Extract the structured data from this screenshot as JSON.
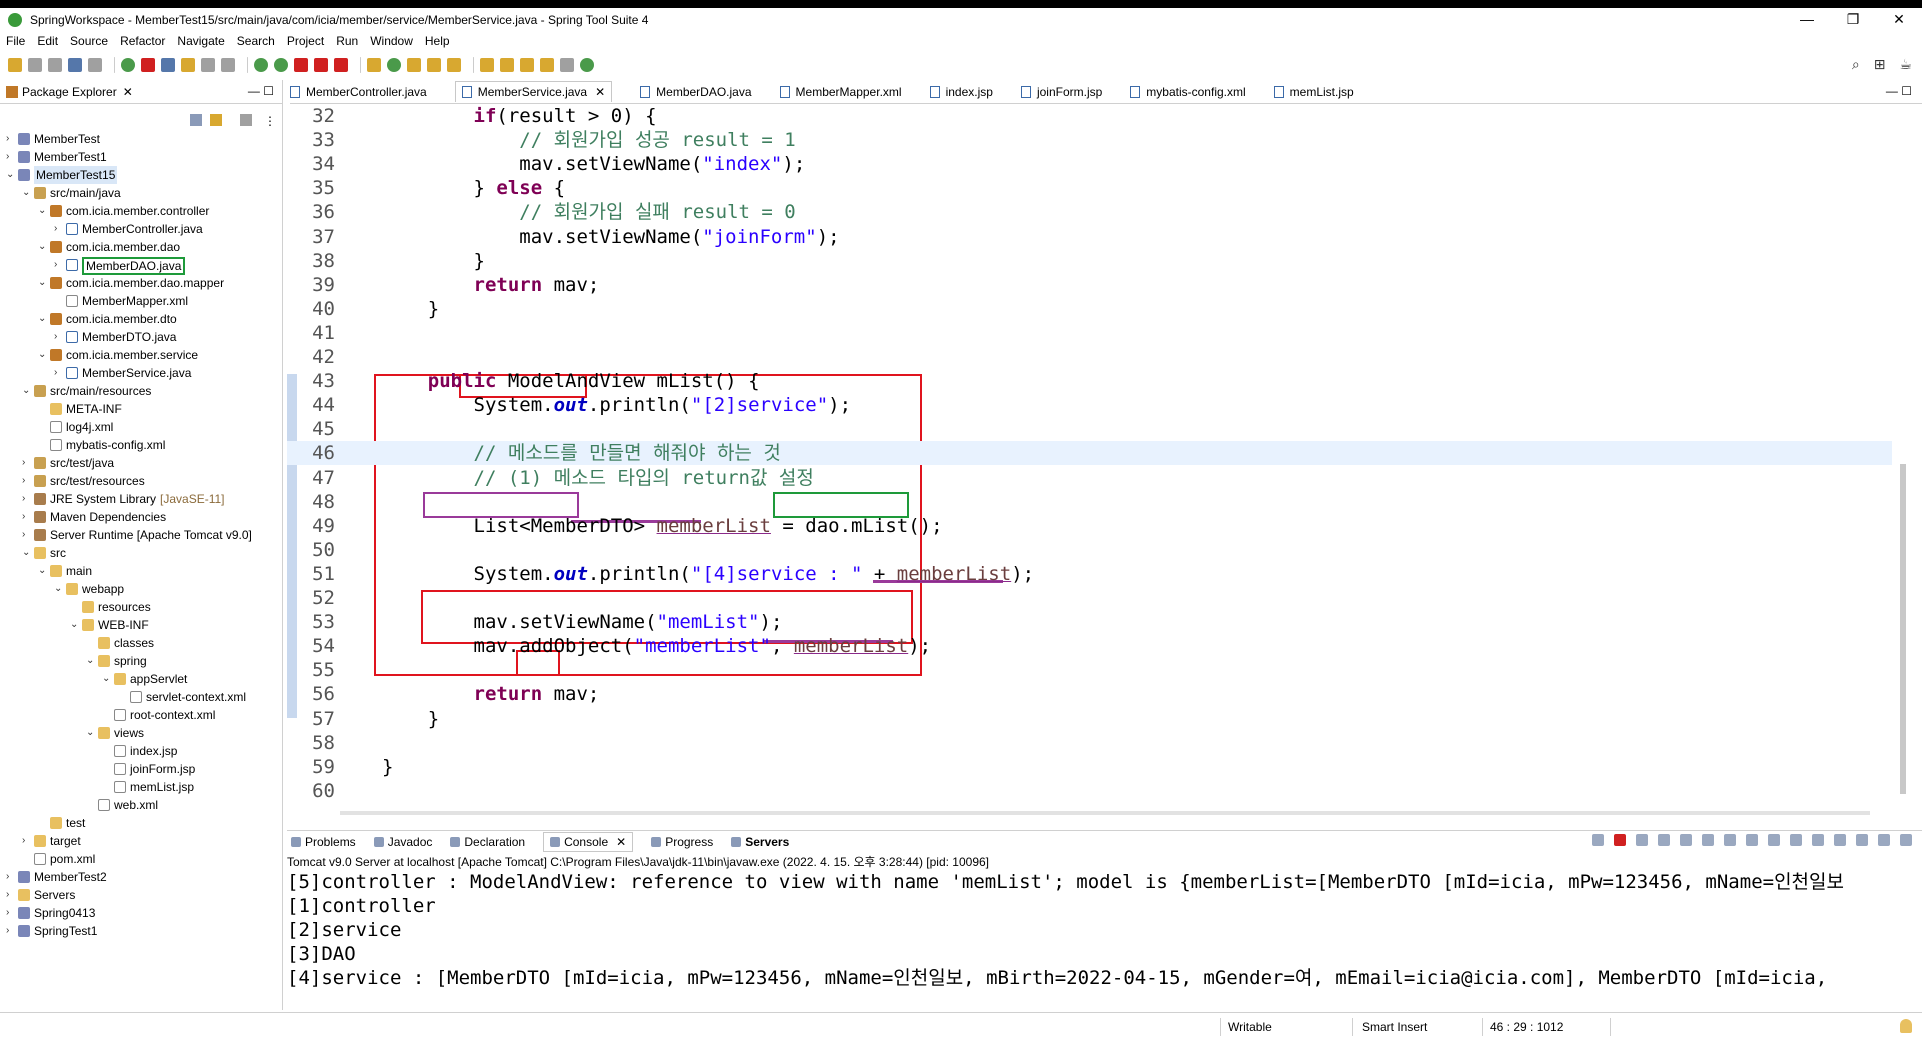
{
  "window": {
    "title": "SpringWorkspace - MemberTest15/src/main/java/com/icia/member/service/MemberService.java - Spring Tool Suite 4",
    "controls": [
      "—",
      "❐",
      "✕"
    ]
  },
  "menu": [
    "File",
    "Edit",
    "Source",
    "Refactor",
    "Navigate",
    "Search",
    "Project",
    "Run",
    "Window",
    "Help"
  ],
  "package_explorer": {
    "tab_label": "Package Explorer",
    "close": "✕",
    "min_max": "— ☐",
    "tree": [
      {
        "label": "MemberTest",
        "depth": 0,
        "icon": "project",
        "twisty": "›"
      },
      {
        "label": "MemberTest1",
        "depth": 0,
        "icon": "project",
        "twisty": "›"
      },
      {
        "label": "MemberTest15",
        "depth": 0,
        "icon": "project",
        "twisty": "⌄",
        "selected": true
      },
      {
        "label": "src/main/java",
        "depth": 1,
        "icon": "srcfolder",
        "twisty": "⌄"
      },
      {
        "label": "com.icia.member.controller",
        "depth": 2,
        "icon": "package",
        "twisty": "⌄"
      },
      {
        "label": "MemberController.java",
        "depth": 3,
        "icon": "java",
        "twisty": "›"
      },
      {
        "label": "com.icia.member.dao",
        "depth": 2,
        "icon": "package",
        "twisty": "⌄"
      },
      {
        "label": "MemberDAO.java",
        "depth": 3,
        "icon": "java",
        "twisty": "›",
        "boxed": true
      },
      {
        "label": "com.icia.member.dao.mapper",
        "depth": 2,
        "icon": "package",
        "twisty": "⌄"
      },
      {
        "label": "MemberMapper.xml",
        "depth": 3,
        "icon": "xml",
        "twisty": ""
      },
      {
        "label": "com.icia.member.dto",
        "depth": 2,
        "icon": "package",
        "twisty": "⌄"
      },
      {
        "label": "MemberDTO.java",
        "depth": 3,
        "icon": "java",
        "twisty": "›"
      },
      {
        "label": "com.icia.member.service",
        "depth": 2,
        "icon": "package",
        "twisty": "⌄"
      },
      {
        "label": "MemberService.java",
        "depth": 3,
        "icon": "java",
        "twisty": "›"
      },
      {
        "label": "src/main/resources",
        "depth": 1,
        "icon": "srcfolder",
        "twisty": "⌄"
      },
      {
        "label": "META-INF",
        "depth": 2,
        "icon": "folder",
        "twisty": ""
      },
      {
        "label": "log4j.xml",
        "depth": 2,
        "icon": "xml",
        "twisty": ""
      },
      {
        "label": "mybatis-config.xml",
        "depth": 2,
        "icon": "xml",
        "twisty": ""
      },
      {
        "label": "src/test/java",
        "depth": 1,
        "icon": "srcfolder",
        "twisty": "›"
      },
      {
        "label": "src/test/resources",
        "depth": 1,
        "icon": "srcfolder",
        "twisty": "›"
      },
      {
        "label": "JRE System Library",
        "extra": "[JavaSE-11]",
        "depth": 1,
        "icon": "lib",
        "twisty": "›"
      },
      {
        "label": "Maven Dependencies",
        "depth": 1,
        "icon": "lib",
        "twisty": "›"
      },
      {
        "label": "Server Runtime [Apache Tomcat v9.0]",
        "depth": 1,
        "icon": "lib",
        "twisty": "›"
      },
      {
        "label": "src",
        "depth": 1,
        "icon": "folder",
        "twisty": "⌄"
      },
      {
        "label": "main",
        "depth": 2,
        "icon": "folder",
        "twisty": "⌄"
      },
      {
        "label": "webapp",
        "depth": 3,
        "icon": "folder",
        "twisty": "⌄"
      },
      {
        "label": "resources",
        "depth": 4,
        "icon": "folder",
        "twisty": ""
      },
      {
        "label": "WEB-INF",
        "depth": 4,
        "icon": "folder",
        "twisty": "⌄"
      },
      {
        "label": "classes",
        "depth": 5,
        "icon": "folder",
        "twisty": ""
      },
      {
        "label": "spring",
        "depth": 5,
        "icon": "folder",
        "twisty": "⌄"
      },
      {
        "label": "appServlet",
        "depth": 6,
        "icon": "folder",
        "twisty": "⌄"
      },
      {
        "label": "servlet-context.xml",
        "depth": 7,
        "icon": "xml",
        "twisty": ""
      },
      {
        "label": "root-context.xml",
        "depth": 6,
        "icon": "xml",
        "twisty": ""
      },
      {
        "label": "views",
        "depth": 5,
        "icon": "folder",
        "twisty": "⌄"
      },
      {
        "label": "index.jsp",
        "depth": 6,
        "icon": "xml",
        "twisty": ""
      },
      {
        "label": "joinForm.jsp",
        "depth": 6,
        "icon": "xml",
        "twisty": ""
      },
      {
        "label": "memList.jsp",
        "depth": 6,
        "icon": "xml",
        "twisty": ""
      },
      {
        "label": "web.xml",
        "depth": 5,
        "icon": "xml",
        "twisty": ""
      },
      {
        "label": "test",
        "depth": 2,
        "icon": "folder",
        "twisty": ""
      },
      {
        "label": "target",
        "depth": 1,
        "icon": "folder",
        "twisty": "›"
      },
      {
        "label": "pom.xml",
        "depth": 1,
        "icon": "xml",
        "twisty": ""
      },
      {
        "label": "MemberTest2",
        "depth": 0,
        "icon": "project",
        "twisty": "›"
      },
      {
        "label": "Servers",
        "depth": 0,
        "icon": "folder",
        "twisty": "›"
      },
      {
        "label": "Spring0413",
        "depth": 0,
        "icon": "project",
        "twisty": "›"
      },
      {
        "label": "SpringTest1",
        "depth": 0,
        "icon": "project",
        "twisty": "›"
      }
    ]
  },
  "editor": {
    "tabs": [
      {
        "label": "MemberController.java",
        "active": false
      },
      {
        "label": "MemberService.java",
        "active": true,
        "close": "✕"
      },
      {
        "label": "MemberDAO.java",
        "active": false
      },
      {
        "label": "MemberMapper.xml",
        "active": false
      },
      {
        "label": "index.jsp",
        "active": false
      },
      {
        "label": "joinForm.jsp",
        "active": false
      },
      {
        "label": "mybatis-config.xml",
        "active": false
      },
      {
        "label": "memList.jsp",
        "active": false
      }
    ],
    "min_max": "— ☐",
    "lines": [
      {
        "n": "32",
        "html": "        <span class=\"kw\">if</span>(result &gt; 0) {"
      },
      {
        "n": "33",
        "html": "            <span class=\"com\">// 회원가입 성공 result = 1</span>"
      },
      {
        "n": "34",
        "html": "            mav.setViewName(<span class=\"str\">\"index\"</span>);"
      },
      {
        "n": "35",
        "html": "        } <span class=\"kw\">else</span> {"
      },
      {
        "n": "36",
        "html": "            <span class=\"com\">// 회원가입 실패 result = 0</span>"
      },
      {
        "n": "37",
        "html": "            mav.setViewName(<span class=\"str\">\"joinForm\"</span>);"
      },
      {
        "n": "38",
        "html": "        }"
      },
      {
        "n": "39",
        "html": "        <span class=\"kw\">return</span> mav;"
      },
      {
        "n": "40",
        "html": "    }"
      },
      {
        "n": "41",
        "html": ""
      },
      {
        "n": "42",
        "html": ""
      },
      {
        "n": "43",
        "html": "    <span class=\"kw\">public</span> ModelAndView mList() {"
      },
      {
        "n": "44",
        "html": "        System.<span class=\"fld\">out</span>.println(<span class=\"str\">\"[2]service\"</span>);"
      },
      {
        "n": "45",
        "html": ""
      },
      {
        "n": "46",
        "html": "        <span class=\"com\">// 메소드를 만들면 해줘야 하는 것</span>",
        "highlight": true
      },
      {
        "n": "47",
        "html": "        <span class=\"com\">// (1) 메소드 타입의 return값 설정</span>"
      },
      {
        "n": "48",
        "html": ""
      },
      {
        "n": "49",
        "html": "        List&lt;MemberDTO&gt; <span class=\"var\">memberList</span> = dao.mList();"
      },
      {
        "n": "50",
        "html": ""
      },
      {
        "n": "51",
        "html": "        System.<span class=\"fld\">out</span>.println(<span class=\"str\">\"[4]service : \"</span> + <span class=\"var\">memberList</span>);"
      },
      {
        "n": "52",
        "html": ""
      },
      {
        "n": "53",
        "html": "        mav.setViewName(<span class=\"str\">\"memList\"</span>);"
      },
      {
        "n": "54",
        "html": "        mav.addObject(<span class=\"str\">\"memberList\"</span>, <span class=\"var\">memberList</span>);"
      },
      {
        "n": "55",
        "html": ""
      },
      {
        "n": "56",
        "html": "        <span class=\"kw\">return</span> mav;"
      },
      {
        "n": "57",
        "html": "    }"
      },
      {
        "n": "58",
        "html": ""
      },
      {
        "n": "59",
        "html": "}"
      },
      {
        "n": "60",
        "html": ""
      }
    ]
  },
  "console": {
    "tabs": [
      {
        "label": "Problems"
      },
      {
        "label": "Javadoc"
      },
      {
        "label": "Declaration"
      },
      {
        "label": "Console",
        "active": true,
        "close": "✕"
      },
      {
        "label": "Progress"
      },
      {
        "label": "Servers",
        "bold": true
      }
    ],
    "header": "Tomcat v9.0 Server at localhost [Apache Tomcat] C:\\Program Files\\Java\\jdk-11\\bin\\javaw.exe  (2022. 4. 15. 오후 3:28:44) [pid: 10096]",
    "lines": [
      "[5]controller : ModelAndView: reference to view with name 'memList'; model is {memberList=[MemberDTO [mId=icia, mPw=123456, mName=인천일보",
      "[1]controller",
      "[2]service",
      "[3]DAO",
      "[4]service : [MemberDTO [mId=icia, mPw=123456, mName=인천일보, mBirth=2022-04-15, mGender=여, mEmail=icia@icia.com], MemberDTO [mId=icia,"
    ]
  },
  "status": {
    "writable": "Writable",
    "insert_mode": "Smart Insert",
    "position": "46 : 29 : 1012"
  },
  "colors": {
    "annotation_red": "#e0141e",
    "annotation_purple": "#9a3a9a",
    "annotation_green": "#1e9a3a",
    "keyword": "#7f0055",
    "string": "#2a00ff",
    "comment": "#3f7f5f"
  }
}
